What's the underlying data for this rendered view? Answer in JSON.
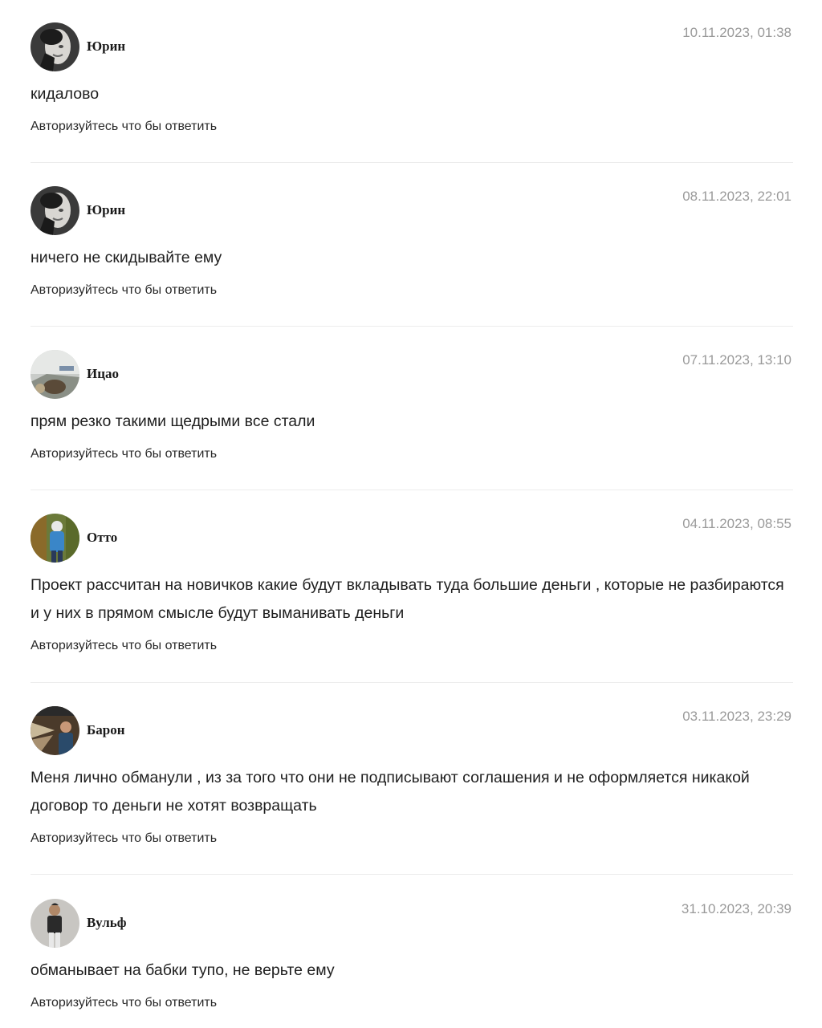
{
  "comments": [
    {
      "author": "Юрин",
      "date": "10.11.2023, 01:38",
      "text": "кидалово",
      "reply": "Авторизуйтесь что бы ответить"
    },
    {
      "author": "Юрин",
      "date": "08.11.2023, 22:01",
      "text": "ничего не скидывайте ему",
      "reply": "Авторизуйтесь что бы ответить"
    },
    {
      "author": "Ицао",
      "date": "07.11.2023, 13:10",
      "text": "прям резко такими щедрыми все стали",
      "reply": "Авторизуйтесь что бы ответить"
    },
    {
      "author": "Отто",
      "date": "04.11.2023, 08:55",
      "text": "Проект рассчитан на новичков какие будут вкладывать туда большие деньги , которые не разбираются и у них в прямом смысле будут выманивать деньги",
      "reply": "Авторизуйтесь что бы ответить"
    },
    {
      "author": "Барон",
      "date": "03.11.2023, 23:29",
      "text": "Меня лично обманули , из за того что они не подписывают соглашения и не оформляется никакой договор то деньги не хотят возвращать",
      "reply": "Авторизуйтесь что бы ответить"
    },
    {
      "author": "Вульф",
      "date": "31.10.2023, 20:39",
      "text": "обманывает на бабки тупо, не верьте ему",
      "reply": "Авторизуйтесь что бы ответить"
    }
  ],
  "colors": {
    "date": "#9a9a9a",
    "divider": "#ececec",
    "text": "#1f1f1f"
  }
}
